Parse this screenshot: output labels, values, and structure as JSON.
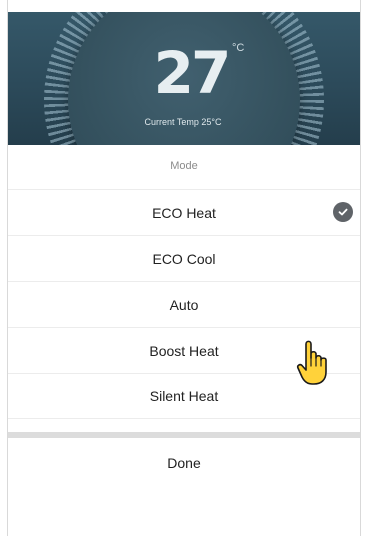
{
  "thermostat": {
    "setpoint": "27",
    "unit": "°C",
    "current_label": "Current Temp 25°C"
  },
  "mode_picker": {
    "title": "Mode",
    "options": [
      {
        "label": "ECO Heat",
        "selected": true
      },
      {
        "label": "ECO Cool",
        "selected": false
      },
      {
        "label": "Auto",
        "selected": false
      },
      {
        "label": "Boost Heat",
        "selected": false
      },
      {
        "label": "Silent Heat",
        "selected": false
      }
    ],
    "done_label": "Done"
  },
  "icons": {
    "selected_indicator": "checkmark-circle-icon",
    "pointer": "hand-pointer-icon"
  },
  "colors": {
    "header_bg": "#2f4f5f",
    "check_bg": "#5f6368",
    "pointer_fill": "#ffd23a"
  }
}
